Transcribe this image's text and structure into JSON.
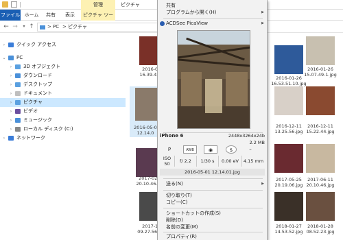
{
  "titlebar": {
    "manage_tab": "管理",
    "window_title": "ピクチャ"
  },
  "ribbon": {
    "tabs": [
      "ファイル",
      "ホーム",
      "共有",
      "表示"
    ],
    "contextual_tab": "ピクチャ ツール"
  },
  "address": {
    "path": [
      "PC",
      "ピクチャ"
    ],
    "separator": ">"
  },
  "navigation": {
    "items": [
      {
        "label": "クイック アクセス",
        "color": "#3b7dd8"
      },
      {
        "label": "PC",
        "color": "#4a90d9"
      },
      {
        "label": "3D オブジェクト",
        "color": "#5aa0e0"
      },
      {
        "label": "ダウンロード",
        "color": "#4a90d9"
      },
      {
        "label": "デスクトップ",
        "color": "#5aa0e0"
      },
      {
        "label": "ドキュメント",
        "color": "#bfbfbf"
      },
      {
        "label": "ピクチャ",
        "color": "#5aa0e0"
      },
      {
        "label": "ビデオ",
        "color": "#6b4fa0"
      },
      {
        "label": "ミュージック",
        "color": "#4a90d9"
      },
      {
        "label": "ローカル ディスク (C:)",
        "color": "#888888"
      },
      {
        "label": "ネットワーク",
        "color": "#3b7dd8"
      }
    ]
  },
  "thumbnails": [
    {
      "cap": "2016-01-0\n16.39.42.jpg",
      "color": "#7a3028"
    },
    {
      "cap": "",
      "color": "#ffffff"
    },
    {
      "cap": "2016-01-26\n16.53.51.10.jpg",
      "color": "#2e5a9a"
    },
    {
      "cap": "2016-01-26\n15.07.49-1.jpg",
      "color": "#c8c0b0"
    },
    {
      "cap": "2016-05-0\n12.14.0",
      "color": "#8a7a6a"
    },
    {
      "cap": "",
      "color": "#ffffff"
    },
    {
      "cap": "2016-12-11\n13.25.56.jpg",
      "color": "#d8d0c8"
    },
    {
      "cap": "2016-12-11\n15.22.44.jpg",
      "color": "#8a4a30"
    },
    {
      "cap": "2017-02-1\n20.10.46.jpg",
      "color": "#5a3a50"
    },
    {
      "cap": "",
      "color": "#ffffff"
    },
    {
      "cap": "2017-05-25\n20.19.06.jpg",
      "color": "#6a2a30"
    },
    {
      "cap": "2017-06-11\n20.10.46.jpg",
      "color": "#c8b8a0"
    },
    {
      "cap": "2017-12-1\n09.27.56-1.jpg",
      "color": "#4a4a4a"
    },
    {
      "cap": "",
      "color": "#ffffff"
    },
    {
      "cap": "2018-01-27\n14.53.52.jpg",
      "color": "#3a3028"
    },
    {
      "cap": "2018-01-28\n08.52.23.jpg",
      "color": "#6a5040"
    }
  ],
  "menu": {
    "share": "共有",
    "open_with": "プログラムから開く(H)",
    "acdsee": "ACDSee PicaView",
    "model": "iPhone 6",
    "dimensions": "2448x3264x24b",
    "filesize": "2.2 MB",
    "exif_top": [
      "P",
      "AWB",
      "",
      "$",
      "–"
    ],
    "exif_bottom": [
      {
        "label": "ISO\n50"
      },
      {
        "label": "f/ 2.2"
      },
      {
        "label": "1/30 s"
      },
      {
        "label": "0.00 eV"
      },
      {
        "label": "4.15 mm"
      }
    ],
    "datetime": "2016-05-01 12.14.01.jpg",
    "send_to": "送る(N)",
    "cut": "切り取り(T)",
    "copy": "コピー(C)",
    "create_shortcut": "ショートカットの作成(S)",
    "delete": "削除(D)",
    "rename": "名前の変更(M)",
    "properties": "プロパティ(R)"
  }
}
